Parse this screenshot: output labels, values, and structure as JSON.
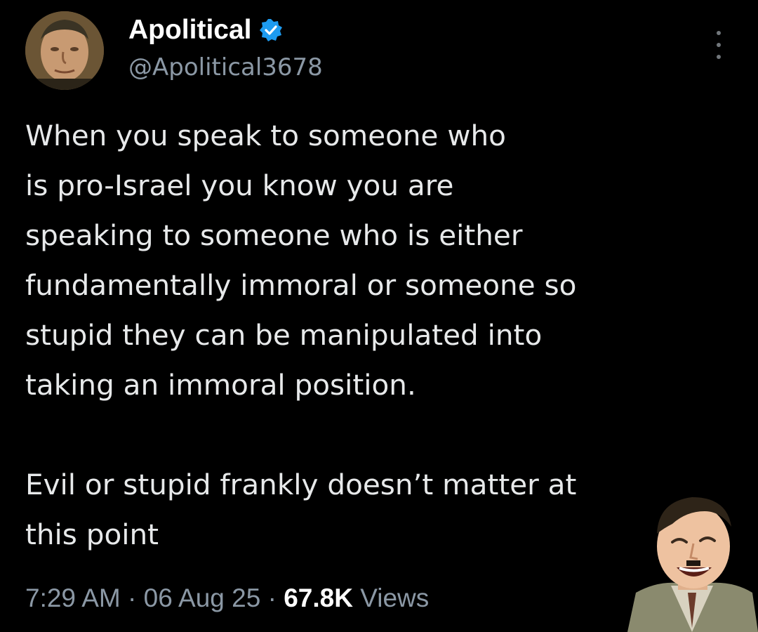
{
  "author": {
    "display_name": "Apolitical",
    "handle": "@Apolitical3678",
    "verified": true,
    "avatar_icon": "avatar-portrait-icon"
  },
  "tweet": {
    "text": "When you speak to someone who\nis pro-Israel you know you are\nspeaking to someone who is either\nfundamentally immoral or someone so\nstupid they can be manipulated into\ntaking an immoral position.\n\nEvil or stupid frankly doesn’t matter at\nthis point",
    "time": "7:29 AM",
    "separator": "·",
    "date": "06 Aug 25",
    "views_count": "67.8K",
    "views_label": "Views"
  },
  "icons": {
    "verified": "verified-badge-icon",
    "more": "more-options-icon",
    "sticker": "laughing-man-sticker"
  },
  "colors": {
    "background": "#000000",
    "text": "#e7e9ea",
    "secondary": "#8b98a5",
    "verified": "#1d9bf0"
  }
}
